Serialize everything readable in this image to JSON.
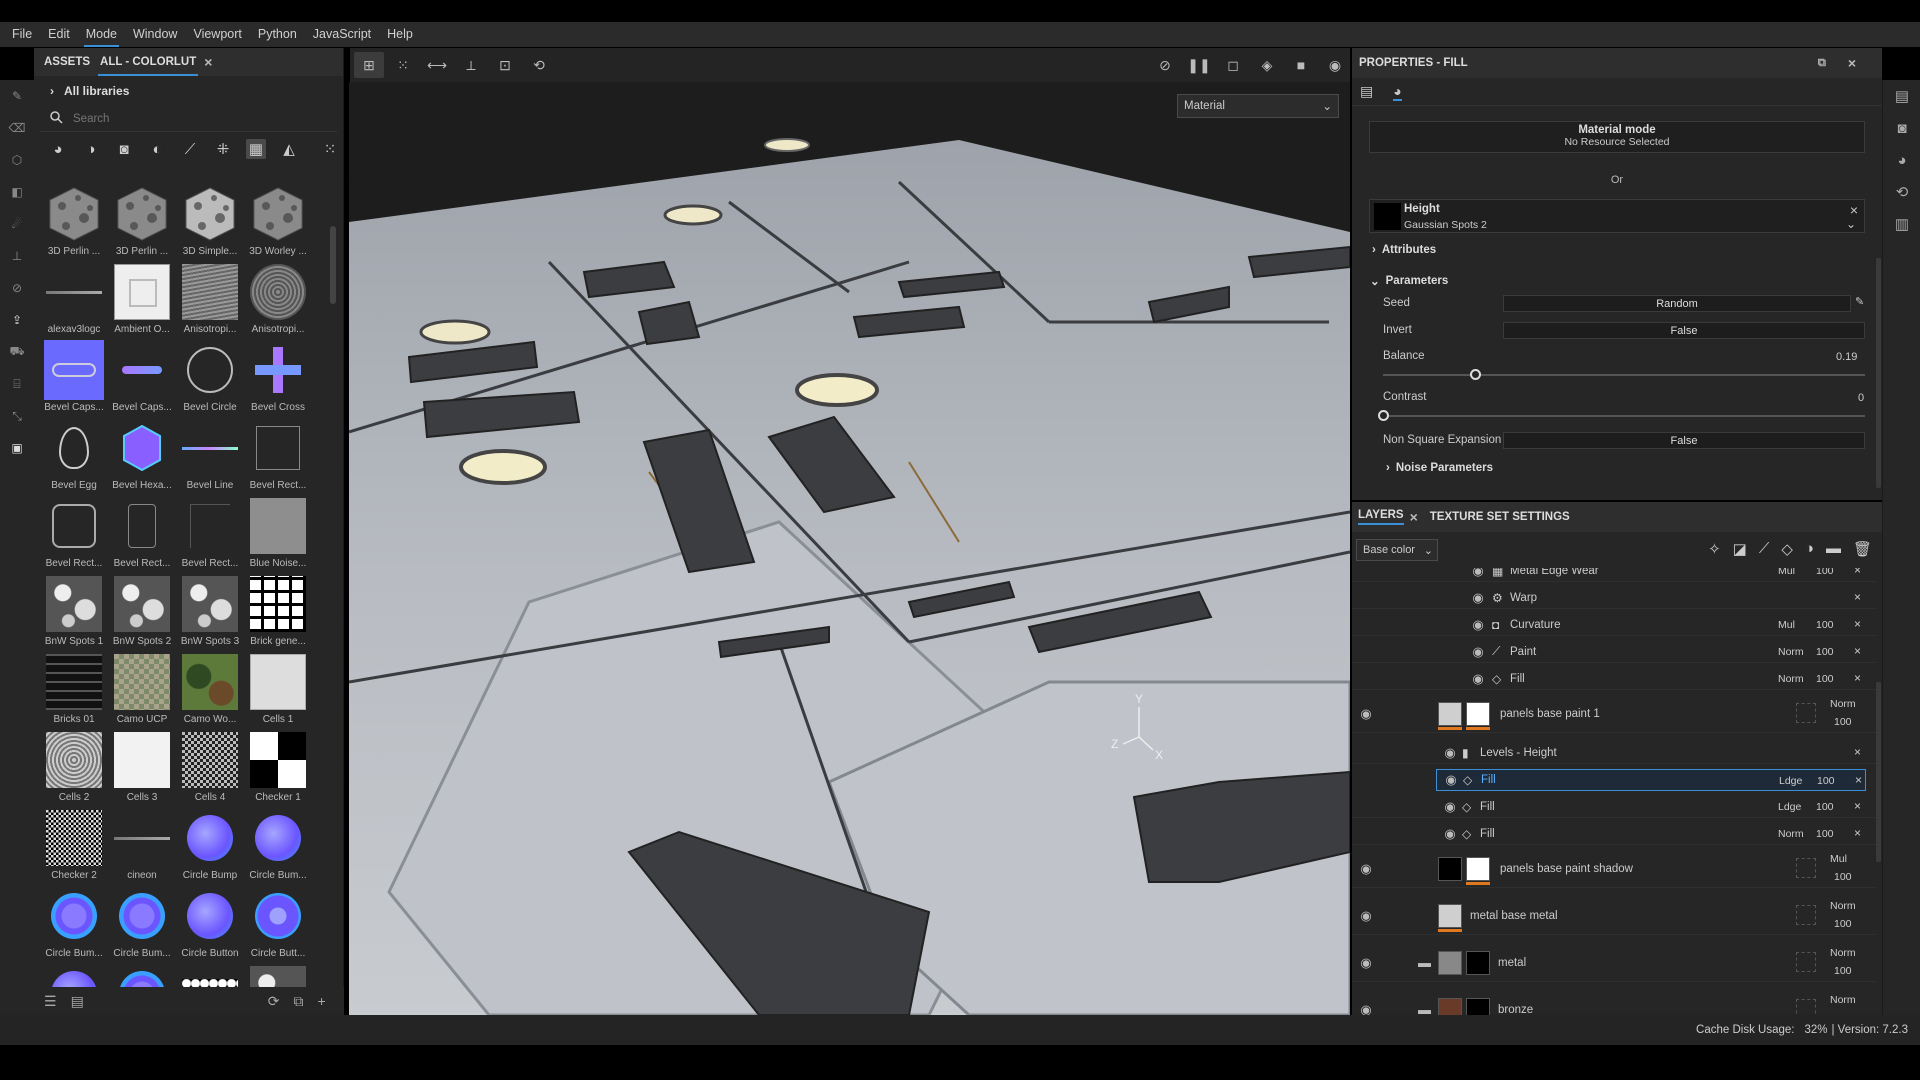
{
  "menu": [
    "File",
    "Edit",
    "Mode",
    "Window",
    "Viewport",
    "Python",
    "JavaScript",
    "Help"
  ],
  "menu_active": "Mode",
  "assets": {
    "tab1": "ASSETS",
    "tab2": "ALL - COLORLUT",
    "libraries": "All libraries",
    "search_placeholder": "Search",
    "items": [
      {
        "label": "3D Perlin ...",
        "kind": "noise-cube"
      },
      {
        "label": "3D Perlin ...",
        "kind": "noise-cube"
      },
      {
        "label": "3D Simple...",
        "kind": "noise-cube-hi"
      },
      {
        "label": "3D Worley ...",
        "kind": "noise-cube"
      },
      {
        "label": "alexav3logc",
        "kind": "line-gray"
      },
      {
        "label": "Ambient O...",
        "kind": "ao"
      },
      {
        "label": "Anisotropi...",
        "kind": "aniso"
      },
      {
        "label": "Anisotropi...",
        "kind": "aniso-swirl"
      },
      {
        "label": "Bevel Caps...",
        "kind": "capsule-sel"
      },
      {
        "label": "Bevel Caps...",
        "kind": "capsule"
      },
      {
        "label": "Bevel Circle",
        "kind": "circle-outline"
      },
      {
        "label": "Bevel Cross",
        "kind": "cross"
      },
      {
        "label": "Bevel Egg",
        "kind": "egg"
      },
      {
        "label": "Bevel Hexa...",
        "kind": "hexa"
      },
      {
        "label": "Bevel Line",
        "kind": "line-color"
      },
      {
        "label": "Bevel Rect...",
        "kind": "rect-outline"
      },
      {
        "label": "Bevel Rect...",
        "kind": "rect-round"
      },
      {
        "label": "Bevel Rect...",
        "kind": "rect-tall"
      },
      {
        "label": "Bevel Rect...",
        "kind": "rect-dark"
      },
      {
        "label": "Blue Noise...",
        "kind": "blue-noise"
      },
      {
        "label": "BnW Spots 1",
        "kind": "spots"
      },
      {
        "label": "BnW Spots 2",
        "kind": "spots"
      },
      {
        "label": "BnW Spots 3",
        "kind": "spots"
      },
      {
        "label": "Brick gene...",
        "kind": "brick-white"
      },
      {
        "label": "Bricks 01",
        "kind": "bricks-dark"
      },
      {
        "label": "Camo UCP",
        "kind": "camo-ucp"
      },
      {
        "label": "Camo Wo...",
        "kind": "camo-wood"
      },
      {
        "label": "Cells 1",
        "kind": "cells1"
      },
      {
        "label": "Cells 2",
        "kind": "cells2"
      },
      {
        "label": "Cells 3",
        "kind": "cells3"
      },
      {
        "label": "Cells 4",
        "kind": "cells4"
      },
      {
        "label": "Checker 1",
        "kind": "checker"
      },
      {
        "label": "Checker 2",
        "kind": "checker2"
      },
      {
        "label": "cineon",
        "kind": "line-gray"
      },
      {
        "label": "Circle Bump",
        "kind": "circle-bump"
      },
      {
        "label": "Circle Bum...",
        "kind": "circle-bump"
      },
      {
        "label": "Circle Bum...",
        "kind": "circle-bump2"
      },
      {
        "label": "Circle Bum...",
        "kind": "circle-bump2"
      },
      {
        "label": "Circle Button",
        "kind": "circle-bump"
      },
      {
        "label": "Circle Butt...",
        "kind": "circle-button2"
      },
      {
        "label": "",
        "kind": "circle-bump"
      },
      {
        "label": "",
        "kind": "circle-bump2"
      },
      {
        "label": "",
        "kind": "dots"
      },
      {
        "label": "",
        "kind": "spots"
      }
    ]
  },
  "viewport": {
    "mode_select": "Material",
    "gizmo": {
      "y": "Y",
      "z": "Z",
      "x": "X"
    }
  },
  "properties": {
    "title": "PROPERTIES - FILL",
    "material_mode": "Material mode",
    "no_resource": "No Resource Selected",
    "or": "Or",
    "height_title": "Height",
    "height_resource": "Gaussian Spots 2",
    "attributes": "Attributes",
    "parameters": "Parameters",
    "params": {
      "seed_label": "Seed",
      "seed_value": "Random",
      "invert_label": "Invert",
      "invert_value": "False",
      "balance_label": "Balance",
      "balance_value": "0.19",
      "balance_fraction": 0.19,
      "contrast_label": "Contrast",
      "contrast_value": "0",
      "contrast_fraction": 0,
      "nse_label": "Non Square Expansion",
      "nse_value": "False"
    },
    "noise_parameters": "Noise Parameters"
  },
  "layers": {
    "tab1": "LAYERS",
    "tab2": "TEXTURE SET SETTINGS",
    "channel": "Base color",
    "rows": [
      {
        "name": "Metal Edge Wear",
        "blend": "Mul",
        "opacity": "100",
        "icon": "mask",
        "indent": 2,
        "cut": true
      },
      {
        "name": "Warp",
        "blend": "",
        "opacity": "",
        "icon": "warp",
        "indent": 2
      },
      {
        "name": "Curvature",
        "blend": "Mul",
        "opacity": "100",
        "icon": "curvature",
        "indent": 2
      },
      {
        "name": "Paint",
        "blend": "Norm",
        "opacity": "100",
        "icon": "brush",
        "indent": 2
      },
      {
        "name": "Fill",
        "blend": "Norm",
        "opacity": "100",
        "icon": "fill",
        "indent": 2
      },
      {
        "name": "panels base paint 1",
        "blend": "Norm",
        "opacity": "100",
        "icon": "layer",
        "indent": 1,
        "big": true
      },
      {
        "name": "Levels - Height",
        "blend": "",
        "opacity": "",
        "icon": "levels",
        "indent": 3
      },
      {
        "name": "Fill",
        "blend": "Ldge",
        "opacity": "100",
        "icon": "fill",
        "indent": 3,
        "selected": true
      },
      {
        "name": "Fill",
        "blend": "Ldge",
        "opacity": "100",
        "icon": "fill",
        "indent": 3
      },
      {
        "name": "Fill",
        "blend": "Norm",
        "opacity": "100",
        "icon": "fill",
        "indent": 3
      },
      {
        "name": "panels base paint shadow",
        "blend": "Mul",
        "opacity": "100",
        "icon": "layer",
        "indent": 1,
        "big": true,
        "dark": true
      },
      {
        "name": "metal base metal",
        "blend": "Norm",
        "opacity": "100",
        "icon": "layer-single",
        "indent": 1,
        "big": true
      },
      {
        "name": "metal",
        "blend": "Norm",
        "opacity": "100",
        "icon": "folder",
        "indent": 0,
        "big": true,
        "folder": true
      },
      {
        "name": "bronze",
        "blend": "Norm",
        "opacity": "",
        "icon": "folder",
        "indent": 0,
        "big": true,
        "folder": true,
        "bronze": true
      }
    ]
  },
  "status": {
    "cache": "Cache Disk Usage:",
    "pct": "32%",
    "version": "| Version: 7.2.3"
  }
}
